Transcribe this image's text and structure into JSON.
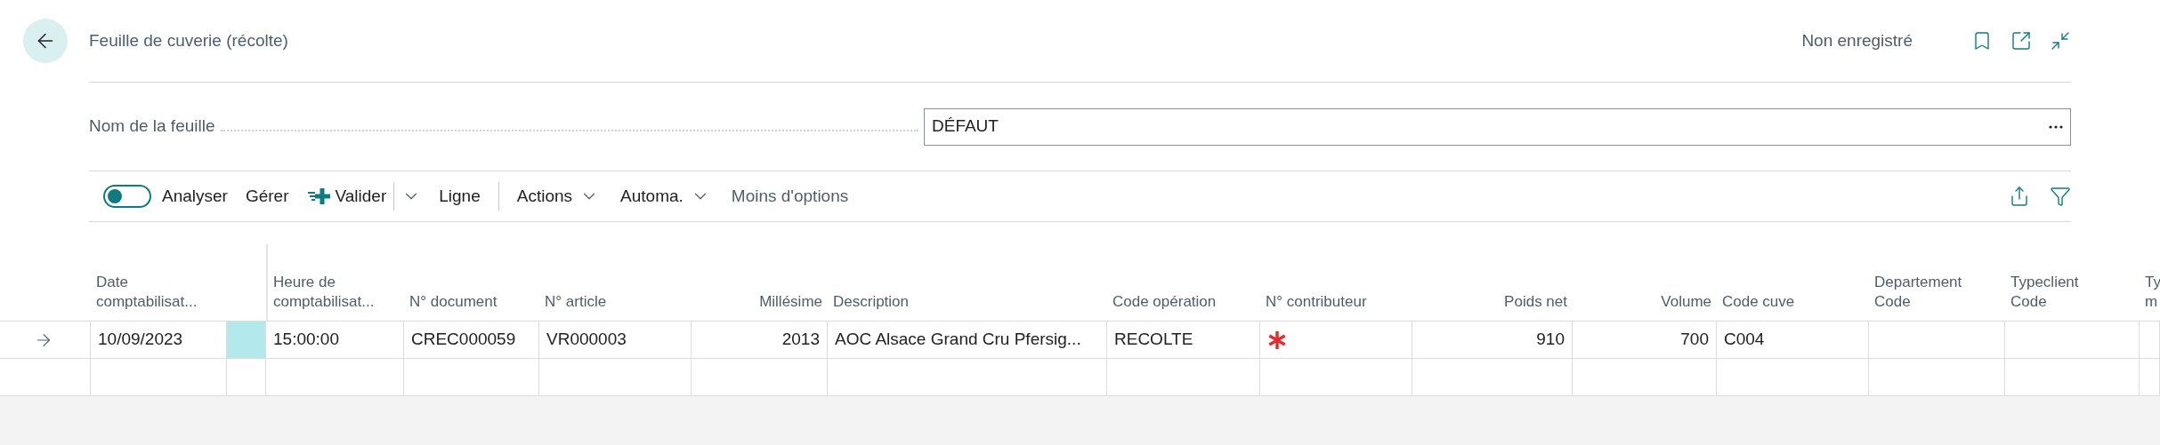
{
  "header": {
    "title": "Feuille de cuverie (récolte)",
    "status": "Non enregistré"
  },
  "field": {
    "label": "Nom de la feuille",
    "value": "DÉFAUT"
  },
  "toolbar": {
    "groups": [
      [
        {
          "kind": "toggle",
          "label": "Analyser",
          "on": false
        },
        {
          "kind": "button",
          "label": "Gérer"
        },
        {
          "kind": "split",
          "label": "Valider"
        },
        {
          "kind": "button",
          "label": "Ligne"
        }
      ],
      [
        {
          "kind": "menu",
          "label": "Actions"
        },
        {
          "kind": "menu",
          "label": "Automa."
        },
        {
          "kind": "link",
          "label": "Moins d'options"
        }
      ]
    ]
  },
  "table": {
    "columns": [
      {},
      {
        "label": "Date comptabilisat...",
        "numeric": false
      },
      {},
      {
        "label": "Heure de comptabilisat...",
        "numeric": false
      },
      {
        "label": "N° document",
        "numeric": false
      },
      {
        "label": "N° article",
        "numeric": false
      },
      {
        "label": "Millésime",
        "numeric": true
      },
      {
        "label": "Description",
        "numeric": false
      },
      {
        "label": "Code opération",
        "numeric": false
      },
      {
        "label": "N° contributeur",
        "numeric": false
      },
      {
        "label": "Poids net",
        "numeric": true
      },
      {
        "label": "Volume",
        "numeric": true
      },
      {
        "label": "Code cuve",
        "numeric": false
      },
      {
        "label": "Departement Code",
        "numeric": false
      },
      {
        "label": "Typeclient Code",
        "numeric": false
      },
      {
        "label": "Ty m",
        "numeric": false
      }
    ],
    "rows": [
      {
        "current": true,
        "cells": [
          {
            "selected": false
          },
          {
            "text": "10/09/2023",
            "selected": false
          },
          {
            "selected": true
          },
          {
            "text": "15:00:00",
            "selected": false
          },
          {
            "text": "CREC000059",
            "selected": false
          },
          {
            "text": "VR000003",
            "selected": false
          },
          {
            "text": "2013",
            "selected": false
          },
          {
            "text": "AOC Alsace Grand Cru Pfersig...",
            "selected": false
          },
          {
            "text": "RECOLTE",
            "selected": false
          },
          {
            "required": true,
            "selected": false
          },
          {
            "text": "910",
            "selected": false
          },
          {
            "text": "700",
            "selected": false
          },
          {
            "text": "C004",
            "selected": false
          },
          {
            "selected": false
          },
          {
            "selected": false
          },
          {
            "selected": false
          }
        ]
      },
      {
        "current": false,
        "cells": [
          {
            "selected": false
          },
          {
            "selected": false
          },
          {
            "selected": false
          },
          {
            "selected": false
          },
          {
            "selected": false
          },
          {
            "selected": false
          },
          {
            "selected": false
          },
          {
            "selected": false
          },
          {
            "selected": false
          },
          {
            "selected": false
          },
          {
            "selected": false
          },
          {
            "selected": false
          },
          {
            "selected": false
          },
          {
            "selected": false
          },
          {
            "selected": false
          },
          {
            "selected": false
          }
        ]
      }
    ]
  }
}
